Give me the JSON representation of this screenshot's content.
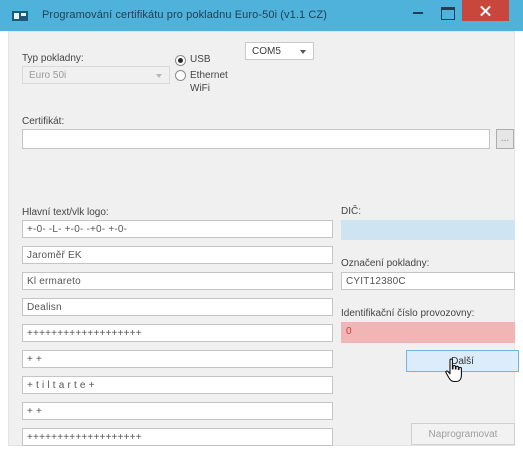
{
  "window": {
    "title": "Programování certifikátu pro pokladnu Euro-50i (v1.1 CZ)"
  },
  "left_panel": {
    "cash_register_type_label": "Typ pokladny:",
    "cash_register_type_value": "Euro 50i",
    "connection": {
      "usb_label": "USB",
      "wifi_label": "Ethernet WiFi",
      "selected": "USB",
      "port_value": "COM5"
    },
    "certificate_label": "Certifikát:",
    "certificate_value": "",
    "browse_label": "...",
    "header_label": "Hlavní text/vlk logo:",
    "header_fields": [
      "+-0- -L- +-0- -+0- +-0-",
      "Jaroměř   EK",
      "Kl ermareto",
      "Dealisn",
      "+++++++++++++++++++",
      "+                          +",
      "+ t i l t a r t e   +",
      "+                          +",
      "+++++++++++++++++++"
    ]
  },
  "right_panel": {
    "dic_label": "DIČ:",
    "dic_value": "",
    "device_label": "Označení pokladny:",
    "device_value": "CYIT12380C",
    "premises_label": "Identifikační číslo provozovny:",
    "premises_value": "0",
    "next_button": "Další",
    "program_button": "Naprogramovat"
  },
  "colors": {
    "titlebar": "#4fb2db",
    "close_button": "#c8463b",
    "dic_field_bg": "#cfe4f3",
    "premises_field_bg": "#f2b5b5",
    "premises_text": "#d33a3a"
  }
}
